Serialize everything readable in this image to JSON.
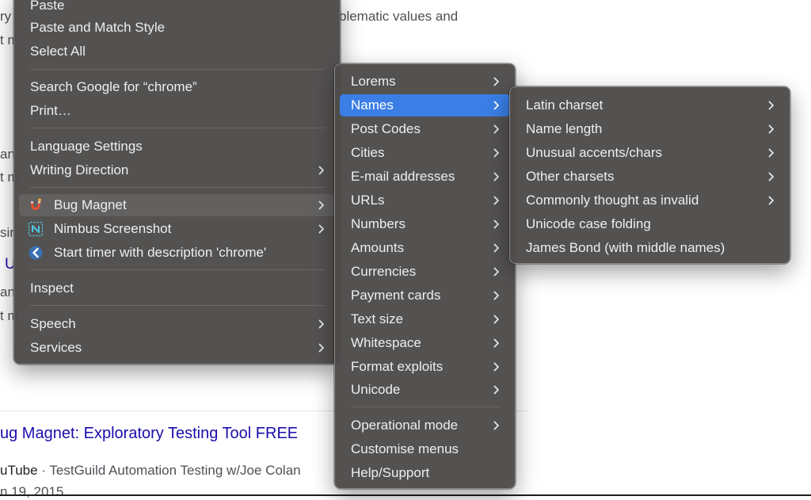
{
  "background": {
    "snippet_line1_left": "ry",
    "snippet_line1_right": "blematic values and",
    "snippet_fragments": [
      "t m",
      "an",
      "t m",
      "sir",
      "U",
      "an",
      "t m"
    ],
    "result_title": "ug Magnet: Exploratory Testing Tool FREE",
    "result_source": "uTube",
    "result_source_sep": "·",
    "result_channel": "TestGuild Automation Testing w/Joe Colan",
    "result_date": "n 19, 2015"
  },
  "context_menu": {
    "items": [
      {
        "label": "Paste"
      },
      {
        "label": "Paste and Match Style"
      },
      {
        "label": "Select All"
      },
      {
        "label": "Search Google for “chrome”"
      },
      {
        "label": "Print…"
      },
      {
        "label": "Language Settings"
      },
      {
        "label": "Writing Direction"
      },
      {
        "label": "Bug Magnet",
        "icon": "bug-magnet-icon"
      },
      {
        "label": "Nimbus Screenshot",
        "icon": "nimbus-icon"
      },
      {
        "label": "Start timer with description 'chrome'",
        "icon": "timer-icon"
      },
      {
        "label": "Inspect"
      },
      {
        "label": "Speech"
      },
      {
        "label": "Services"
      }
    ]
  },
  "bug_magnet_menu": {
    "items": [
      {
        "label": "Lorems"
      },
      {
        "label": "Names"
      },
      {
        "label": "Post Codes"
      },
      {
        "label": "Cities"
      },
      {
        "label": "E-mail addresses"
      },
      {
        "label": "URLs"
      },
      {
        "label": "Numbers"
      },
      {
        "label": "Amounts"
      },
      {
        "label": "Currencies"
      },
      {
        "label": "Payment cards"
      },
      {
        "label": "Text size"
      },
      {
        "label": "Whitespace"
      },
      {
        "label": "Format exploits"
      },
      {
        "label": "Unicode"
      },
      {
        "label": "Operational mode"
      },
      {
        "label": "Customise menus"
      },
      {
        "label": "Help/Support"
      }
    ]
  },
  "names_menu": {
    "items": [
      {
        "label": "Latin charset"
      },
      {
        "label": "Name length"
      },
      {
        "label": "Unusual accents/chars"
      },
      {
        "label": "Other charsets"
      },
      {
        "label": "Commonly thought as invalid"
      },
      {
        "label": "Unicode case folding"
      },
      {
        "label": "James Bond (with middle names)"
      }
    ]
  },
  "colors": {
    "menu_background": "#4e4c4b",
    "selection_blue": "#3a7ee6",
    "hover_gray": "#636160",
    "menu_text": "#eeeeee",
    "link_blue": "#1a0dab"
  }
}
